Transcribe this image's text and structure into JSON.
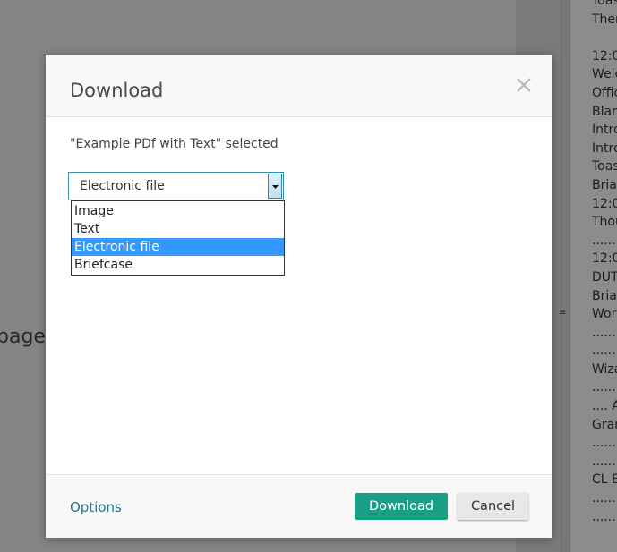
{
  "background": {
    "partial_text": "page c",
    "right_panel_lines": [
      "Toas",
      "Ther",
      "",
      "12:0",
      "Welc",
      "Offic",
      "Blan",
      "Intro",
      "Intro",
      "Toas",
      "Bria",
      "12:0",
      "Thou",
      "......",
      "12:0",
      "DUT",
      "Bria",
      "Worl",
      "......",
      "......",
      "Wiza",
      "......",
      ".... A",
      "Gran",
      "......",
      "......",
      "CL E",
      "......",
      "......"
    ],
    "grip_glyph": "≡"
  },
  "dialog": {
    "title": "Download",
    "close_glyph": "×",
    "selected_note": "\"Example PDf with Text\" selected",
    "format_select": {
      "value": "Electronic file",
      "options": [
        "Image",
        "Text",
        "Electronic file",
        "Briefcase"
      ],
      "selected_index": 2
    },
    "footer": {
      "options_label": "Options",
      "download_label": "Download",
      "cancel_label": "Cancel"
    }
  },
  "colors": {
    "accent": "#17a085",
    "link": "#1f7a94",
    "selection": "#3399ff"
  }
}
